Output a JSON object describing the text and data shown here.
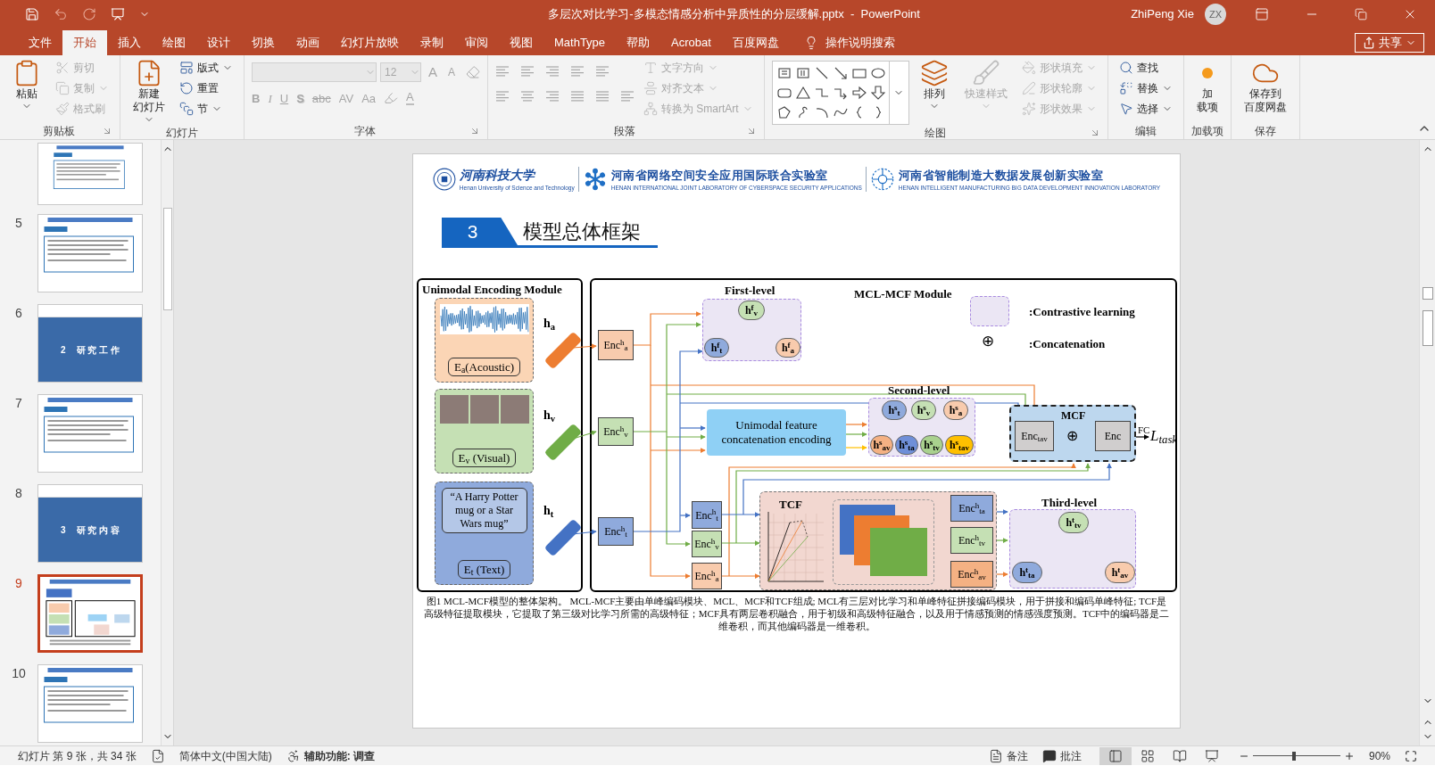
{
  "title_bar": {
    "title": "多层次对比学习-多模态情感分析中异质性的分层缓解.pptx  -  PowerPoint",
    "user": "ZhiPeng Xie",
    "initials": "ZX"
  },
  "menu_tabs": [
    {
      "label": "文件",
      "selected": false
    },
    {
      "label": "开始",
      "selected": true
    },
    {
      "label": "插入",
      "selected": false
    },
    {
      "label": "绘图",
      "selected": false
    },
    {
      "label": "设计",
      "selected": false
    },
    {
      "label": "切换",
      "selected": false
    },
    {
      "label": "动画",
      "selected": false
    },
    {
      "label": "幻灯片放映",
      "selected": false
    },
    {
      "label": "录制",
      "selected": false
    },
    {
      "label": "审阅",
      "selected": false
    },
    {
      "label": "视图",
      "selected": false
    },
    {
      "label": "MathType",
      "selected": false
    },
    {
      "label": "帮助",
      "selected": false
    },
    {
      "label": "Acrobat",
      "selected": false
    },
    {
      "label": "百度网盘",
      "selected": false
    }
  ],
  "tell_me": "操作说明搜索",
  "share": "共享",
  "ribbon": [
    {
      "label": "剪贴板",
      "launcher": true,
      "controls": [
        {
          "kind": "large",
          "lines": [
            "粘贴"
          ],
          "disabled": false,
          "dropdown": true
        },
        {
          "kind": "stack",
          "items": [
            {
              "text": "剪切",
              "disabled": true,
              "dropdown": false
            },
            {
              "text": "复制",
              "disabled": true,
              "dropdown": true
            },
            {
              "text": "格式刷",
              "disabled": true,
              "dropdown": false
            }
          ]
        }
      ]
    },
    {
      "label": "幻灯片",
      "launcher": false,
      "controls": [
        {
          "kind": "large",
          "lines": [
            "新建",
            "幻灯片"
          ],
          "disabled": false,
          "dropdown": true
        },
        {
          "kind": "stack",
          "items": [
            {
              "text": "版式",
              "disabled": false,
              "dropdown": true
            },
            {
              "text": "重置",
              "disabled": false,
              "dropdown": false
            },
            {
              "text": "节",
              "disabled": false,
              "dropdown": true
            }
          ]
        }
      ]
    },
    {
      "label": "字体",
      "launcher": true,
      "controls": [
        {
          "kind": "font",
          "disabled": true,
          "size": "12",
          "row1": [
            {
              "text": "A"
            },
            {
              "text": "A"
            }
          ],
          "row2": [
            {
              "text": "B"
            },
            {
              "text": "I"
            },
            {
              "text": "U"
            },
            {
              "text": "S"
            },
            {
              "text": "abc"
            },
            {
              "text": "AV"
            },
            {
              "text": "Aa"
            },
            {
              "text": "A"
            }
          ]
        }
      ]
    },
    {
      "label": "段落",
      "launcher": true,
      "controls": [
        {
          "kind": "paragraph",
          "disabled": true
        },
        {
          "kind": "stack",
          "items": [
            {
              "text": "文字方向",
              "disabled": true,
              "dropdown": true
            },
            {
              "text": "对齐文本",
              "disabled": true,
              "dropdown": true
            },
            {
              "text": "转换为 SmartArt",
              "disabled": true,
              "dropdown": true
            }
          ]
        }
      ]
    },
    {
      "label": "绘图",
      "launcher": true,
      "controls": [
        {
          "kind": "gallery"
        },
        {
          "kind": "large",
          "lines": [
            "排列"
          ],
          "disabled": false,
          "dropdown": true
        },
        {
          "kind": "large",
          "lines": [
            "快速样式"
          ],
          "disabled": true,
          "dropdown": true
        },
        {
          "kind": "stack",
          "items": [
            {
              "text": "形状填充",
              "disabled": true,
              "dropdown": true
            },
            {
              "text": "形状轮廓",
              "disabled": true,
              "dropdown": true
            },
            {
              "text": "形状效果",
              "disabled": true,
              "dropdown": true
            }
          ]
        }
      ]
    },
    {
      "label": "编辑",
      "launcher": false,
      "controls": [
        {
          "kind": "stack",
          "items": [
            {
              "text": "查找",
              "disabled": false,
              "dropdown": false
            },
            {
              "text": "替换",
              "disabled": false,
              "dropdown": true
            },
            {
              "text": "选择",
              "disabled": false,
              "dropdown": true
            }
          ]
        }
      ]
    },
    {
      "label": "加载项",
      "launcher": false,
      "controls": [
        {
          "kind": "large",
          "lines": [
            "加",
            "载项"
          ],
          "disabled": false,
          "dropdown": false
        }
      ]
    },
    {
      "label": "保存",
      "launcher": false,
      "controls": [
        {
          "kind": "large",
          "lines": [
            "保存到",
            "百度网盘"
          ],
          "disabled": false,
          "dropdown": false
        }
      ]
    }
  ],
  "slides": [
    {
      "kind": "text",
      "selected": false
    },
    {
      "number": "5",
      "kind": "text",
      "selected": false
    },
    {
      "number": "6",
      "kind": "section",
      "section_number": "2",
      "heading": "研 究 工 作",
      "selected": false
    },
    {
      "number": "7",
      "kind": "text",
      "selected": false
    },
    {
      "number": "8",
      "kind": "section",
      "section_number": "3",
      "heading": "研 究 内 容",
      "selected": false
    },
    {
      "number": "9",
      "kind": "figure",
      "selected": true
    },
    {
      "number": "10",
      "kind": "text",
      "selected": false
    }
  ],
  "slide": {
    "logos": [
      {
        "name": "河南科技大学",
        "subtitle": "Henan University of Science and Technology"
      },
      {
        "name": "河南省网络空间安全应用国际联合实验室",
        "subtitle": "HENAN INTERNATIONAL JOINT LABORATORY OF CYBERSPACE SECURITY APPLICATIONS"
      },
      {
        "name": "河南省智能制造大数据发展创新实验室",
        "subtitle": "HENAN INTELLIGENT MANUFACTURING BIG DATA DEVELOPMENT INNOVATION LABORATORY"
      }
    ],
    "section": {
      "number": "3",
      "title": "模型总体框架"
    },
    "figure": {
      "modalities_title": "Unimodal Encoding Module",
      "modalities": [
        {
          "kind": "audio",
          "encoder": "E$_{a}$(Acoustic)",
          "feature": "h$_{a}$",
          "color": "#ed7d31"
        },
        {
          "kind": "video",
          "encoder": "E$_{v}$ (Visual)",
          "feature": "h$_{v}$",
          "color": "#70ad47"
        },
        {
          "kind": "text",
          "quote": "“A Harry Potter mug or a Star Wars mug”",
          "encoder": "E$_{t}$ (Text)",
          "feature": "h$_{t}$",
          "color": "#4472c4"
        }
      ],
      "module_title": "MCL-MCF Module",
      "encoders": [
        {
          "label": "Enc$^{h}$$_{a}$",
          "color": "#f8cbad"
        },
        {
          "label": "Enc$^{h}$$_{v}$",
          "color": "#c5e0b4"
        },
        {
          "label": "Enc$^{h}$$_{t}$",
          "color": "#8faadc"
        }
      ],
      "first_level": {
        "title": "First-level",
        "nodes": [
          {
            "label": "h$^{f}$$_{v}$",
            "color": "#c5e0b4"
          },
          {
            "label": "h$^{f}$$_{t}$",
            "color": "#8faadc"
          },
          {
            "label": "h$^{f}$$_{a}$",
            "color": "#f8cbad"
          }
        ]
      },
      "legend": [
        {
          "kind": "contrastive",
          "label": ":Contrastive learning"
        },
        {
          "kind": "concat",
          "symbol": "⊕",
          "label": ":Concatenation"
        }
      ],
      "concat_block": "Unimodal feature concatenation  encoding",
      "second_level": {
        "title": "Second-level",
        "nodes": [
          {
            "label": "h$^{s}$$_{t}$",
            "color": "#8faadc"
          },
          {
            "label": "h$^{s}$$_{v}$",
            "color": "#c5e0b4"
          },
          {
            "label": "h$^{s}$$_{a}$",
            "color": "#f8cbad"
          },
          {
            "label": "h$^{s}$$_{av}$",
            "color": "#f4b183"
          },
          {
            "label": "h$^{s}$$_{ta}$",
            "color": "#6f8fd8"
          },
          {
            "label": "h$^{s}$$_{tv}$",
            "color": "#a9d18e"
          },
          {
            "label": "h$^{s}$$_{tav}$",
            "color": "#ffc000"
          }
        ]
      },
      "mcf": {
        "title": "MCF",
        "encoder": "Enc$_{tav}$",
        "symbol": "⊕",
        "output_encoder": "Enc",
        "fc": "FC",
        "loss": "L$_{task}$"
      },
      "tcf": {
        "title": "TCF",
        "inputs": [
          {
            "label": "Enc$^{h}$$_{t}$",
            "color": "#8faadc"
          },
          {
            "label": "Enc$^{h}$$_{v}$",
            "color": "#c5e0b4"
          },
          {
            "label": "Enc$^{h}$$_{a}$",
            "color": "#f8cbad"
          }
        ],
        "outputs": [
          {
            "label": "Enc$^{h}$$_{ta}$",
            "color": "#8faadc"
          },
          {
            "label": "Enc$^{h}$$_{tv}$",
            "color": "#c5e0b4"
          },
          {
            "label": "Enc$^{h}$$_{av}$",
            "color": "#f4b183"
          }
        ]
      },
      "third_level": {
        "title": "Third-level",
        "nodes": [
          {
            "label": "h$^{t}$$_{tv}$",
            "color": "#c5e0b4"
          },
          {
            "label": "h$^{t}$$_{ta}$",
            "color": "#8faadc"
          },
          {
            "label": "h$^{t}$$_{av}$",
            "color": "#f8cbad"
          }
        ]
      }
    },
    "caption": "图1 MCL-MCF模型的整体架构。 MCL-MCF主要由单峰编码模块、MCL、MCF和TCF组成; MCL有三层对比学习和单峰特征拼接编码模块，用于拼接和编码单峰特征; TCF是高级特征提取模块，它提取了第三级对比学习所需的高级特征；MCF具有两层卷积融合，用于初级和高级特征融合，以及用于情感预测的情感强度预测。TCF中的编码器是二维卷积，而其他编码器是一维卷积。"
  },
  "status_bar": {
    "slide_info": "幻灯片 第 9 张，共 34 张",
    "language": "简体中文(中国大陆)",
    "accessibility": "辅助功能: 调查",
    "notes": "备注",
    "comments": "批注",
    "views": [
      {
        "selected": true
      },
      {
        "selected": false
      },
      {
        "selected": false
      },
      {
        "selected": false
      }
    ],
    "zoom": {
      "level": 0.47
    },
    "zoom_text": "90%"
  }
}
